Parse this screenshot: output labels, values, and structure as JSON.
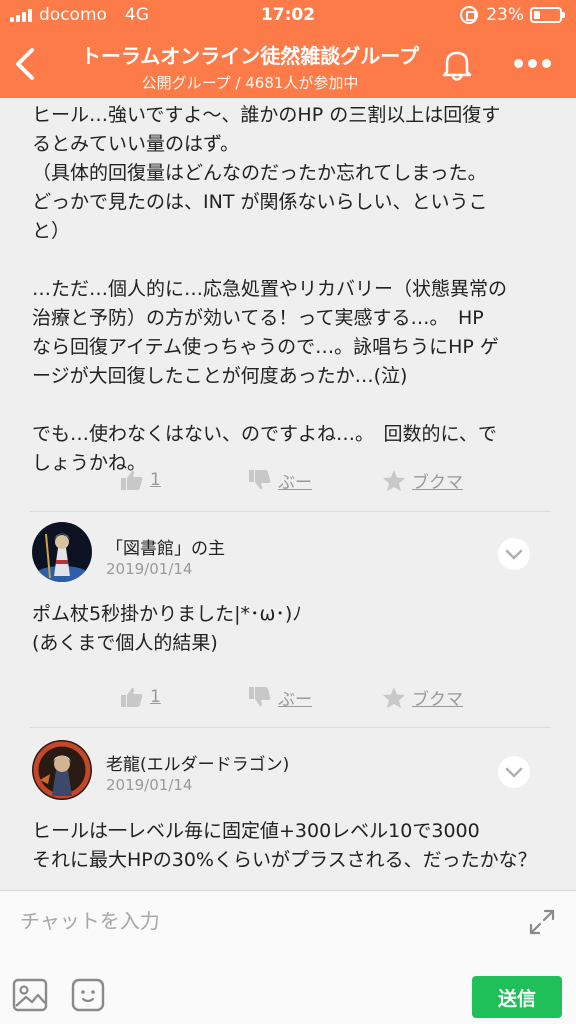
{
  "status_bar": {
    "carrier": "docomo",
    "network": "4G",
    "time": "17:02",
    "battery_percent": "23%",
    "battery_level": 0.23
  },
  "header": {
    "title": "トーラムオンライン徒然雑談グループ",
    "subtitle": "公開グループ / 4681人が参加中",
    "back_icon": "chevron-left-icon",
    "bell_icon": "bell-icon",
    "more_icon": "more-dots-icon"
  },
  "messages": [
    {
      "body": "ヒール…強いですよ〜、誰かのHP の三割以上は回復す\nるとみていい量のはず。\n（具体的回復量はどんなのだったか忘れてしまった。\nどっかで見たのは、INT が関係ないらしい、というこ\nと）\n\n…ただ…個人的に…応急処置やリカバリー（状態異常の\n治療と予防）の方が効いてる！って実感する…。　HP\nなら回復アイテム使っちゃうので…。詠唱ちうにHP ゲ\nージが大回復したことが何度あったか…(泣)\n\nでも…使わなくはない、のですよね…。　回数的に、で\nしょうかね。",
      "like_count": "1",
      "boo_label": "ぶー",
      "bookmark_label": "ブクマ"
    },
    {
      "user": "「図書館」の主",
      "date": "2019/01/14",
      "body": "ポム杖5秒掛かりました|*･ω･)ﾉ\n(あくまで個人的結果)",
      "like_count": "1",
      "boo_label": "ぶー",
      "bookmark_label": "ブクマ"
    },
    {
      "user": "老龍(エルダードラゴン)",
      "date": "2019/01/14",
      "body": "ヒールは一レベル毎に固定値+300レベル10で3000\nそれに最大HPの30%くらいがプラスされる、だったかな？"
    }
  ],
  "chat": {
    "placeholder": "チャットを入力",
    "send_label": "送信"
  },
  "colors": {
    "header": "#fd7b49",
    "send": "#1fbf59",
    "background": "#efefef"
  }
}
